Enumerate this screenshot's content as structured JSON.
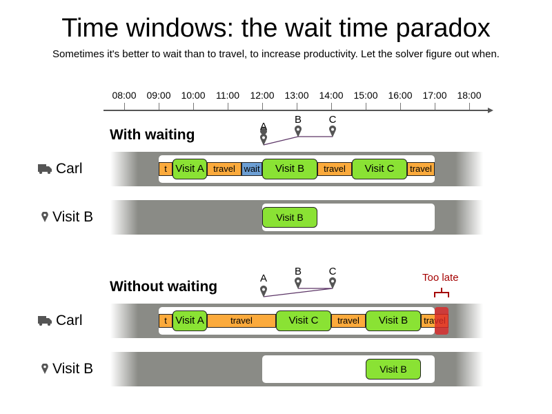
{
  "title": "Time windows: the wait time paradox",
  "subtitle": "Sometimes it's better to wait than to travel, to increase productivity. Let the solver figure out when.",
  "timeline": {
    "ticks": [
      "08:00",
      "09:00",
      "10:00",
      "11:00",
      "12:00",
      "13:00",
      "14:00",
      "15:00",
      "16:00",
      "17:00",
      "18:00"
    ]
  },
  "colors": {
    "travel": "#fbaa3c",
    "wait": "#6d9fd4",
    "visit": "#8ae234",
    "lane": "#8a8b86",
    "too_late": "#a40000",
    "route_line": "#5c3566"
  },
  "sections": [
    {
      "title": "With waiting",
      "map_points": [
        "A",
        "B",
        "C"
      ],
      "vehicle": {
        "label": "Carl",
        "icon": "truck-icon",
        "segments": [
          {
            "type": "travel",
            "label": "t",
            "start": "09:00",
            "end": "09:24"
          },
          {
            "type": "visit",
            "label": "Visit A",
            "start": "09:24",
            "end": "10:24"
          },
          {
            "type": "travel",
            "label": "travel",
            "start": "10:24",
            "end": "11:24"
          },
          {
            "type": "wait",
            "label": "wait",
            "start": "11:24",
            "end": "12:00"
          },
          {
            "type": "visit",
            "label": "Visit B",
            "start": "12:00",
            "end": "13:36"
          },
          {
            "type": "travel",
            "label": "travel",
            "start": "13:36",
            "end": "14:36"
          },
          {
            "type": "visit",
            "label": "Visit C",
            "start": "14:36",
            "end": "16:12"
          },
          {
            "type": "travel",
            "label": "travel",
            "start": "16:12",
            "end": "17:00"
          }
        ]
      },
      "visit_row": {
        "label": "Visit B",
        "icon": "map-pin-icon",
        "window": {
          "start": "12:00",
          "end": "17:00"
        },
        "visit": {
          "label": "Visit B",
          "start": "12:00",
          "end": "13:36"
        }
      }
    },
    {
      "title": "Without waiting",
      "map_points": [
        "A",
        "B",
        "C"
      ],
      "too_late_label": "Too late",
      "vehicle": {
        "label": "Carl",
        "icon": "truck-icon",
        "segments": [
          {
            "type": "travel",
            "label": "t",
            "start": "09:00",
            "end": "09:24"
          },
          {
            "type": "visit",
            "label": "Visit A",
            "start": "09:24",
            "end": "10:24"
          },
          {
            "type": "travel",
            "label": "travel",
            "start": "10:24",
            "end": "12:24"
          },
          {
            "type": "visit",
            "label": "Visit C",
            "start": "12:24",
            "end": "14:00"
          },
          {
            "type": "travel",
            "label": "travel",
            "start": "14:00",
            "end": "15:00"
          },
          {
            "type": "visit",
            "label": "Visit B",
            "start": "15:00",
            "end": "16:36"
          },
          {
            "type": "travel",
            "label": "travel",
            "start": "16:36",
            "end": "17:24"
          }
        ]
      },
      "visit_row": {
        "label": "Visit B",
        "icon": "map-pin-icon",
        "window": {
          "start": "12:00",
          "end": "17:00"
        },
        "visit": {
          "label": "Visit B",
          "start": "15:00",
          "end": "16:36"
        }
      }
    }
  ]
}
